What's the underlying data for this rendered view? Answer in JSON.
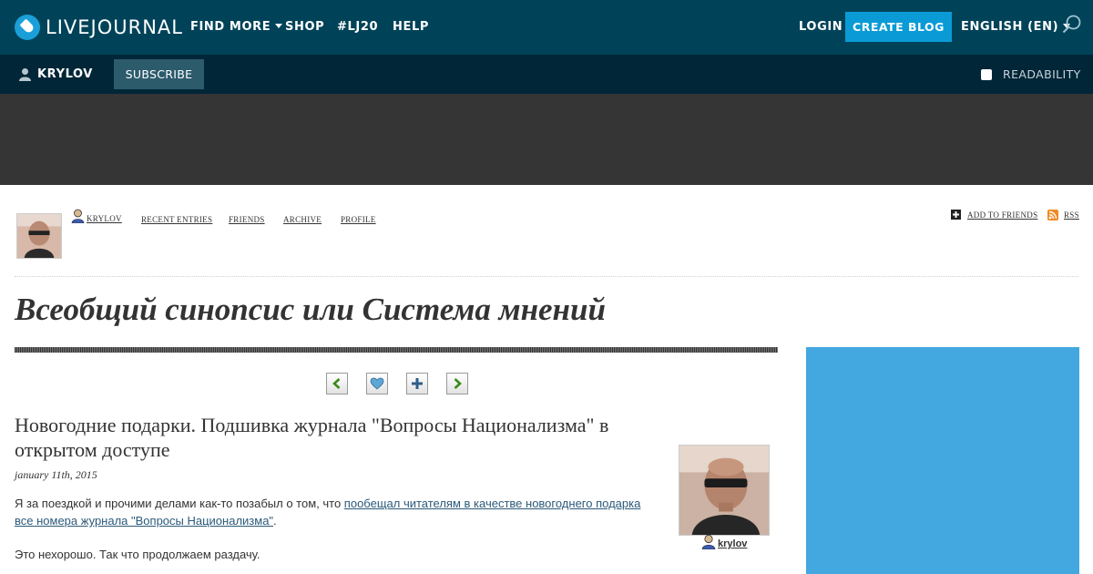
{
  "topbar": {
    "logo_text": "LIVEJOURNAL",
    "nav": {
      "find_more": "FIND MORE",
      "shop": "SHOP",
      "lj20": "#LJ20",
      "help": "HELP"
    },
    "login": "LOGIN",
    "create_blog": "CREATE BLOG",
    "language": "ENGLISH (EN)",
    "search_icon": "search-icon"
  },
  "subbar": {
    "username": "KRYLOV",
    "subscribe": "SUBSCRIBE",
    "readability": "READABILITY"
  },
  "journal_nav": {
    "user": "KRYLOV",
    "recent_entries": "RECENT ENTRIES",
    "friends": "FRIENDS",
    "archive": "ARCHIVE",
    "profile": "PROFILE",
    "add_to_friends": "ADD TO FRIENDS",
    "rss": "RSS"
  },
  "journal": {
    "title": "Всеобщий синопсис или Система мнений"
  },
  "entry": {
    "title": "Новогодние подарки. Подшивка журнала \"Вопросы Национализма\" в открытом доступе",
    "date": "january 11th, 2015",
    "p1_text": "Я за поездкой и прочими делами как-то позабыл о том, что ",
    "p1_link": "пообещал читателям в качестве новогоднего подарка все номера журнала \"Вопросы Национализма\"",
    "p1_end": ".",
    "p2_text": "Это нехорошо. Так что продолжаем раздачу.",
    "poster": "krylov"
  },
  "colors": {
    "topbar": "#004359",
    "subbar": "#002638",
    "accent": "#0a9bd6",
    "ad_strip": "#353535",
    "sidebar_ad": "#43a7e0"
  }
}
